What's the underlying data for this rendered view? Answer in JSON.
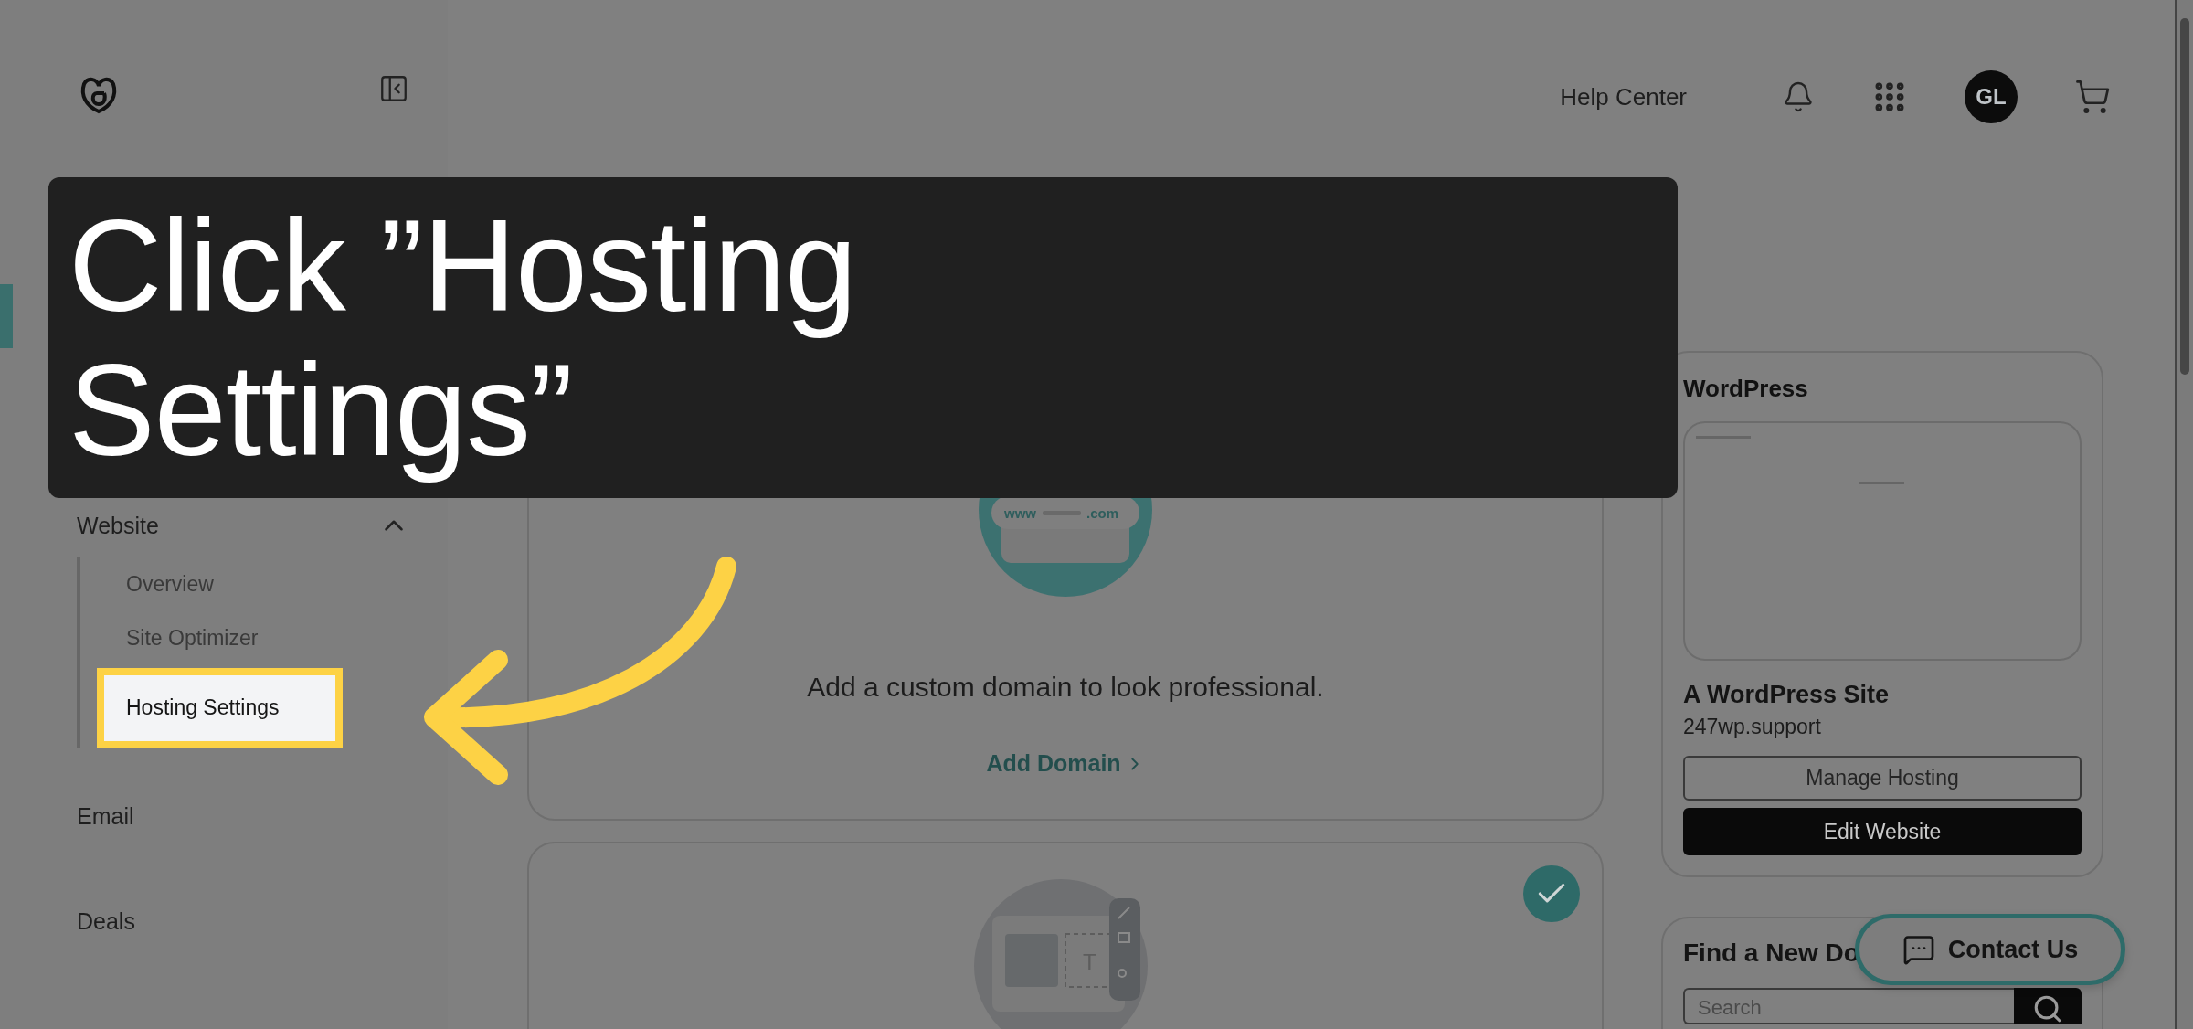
{
  "header": {
    "help_link": "Help Center",
    "avatar_initials": "GL"
  },
  "sidebar": {
    "items": [
      {
        "kind": "group",
        "label": "Website",
        "expanded": true,
        "children": [
          {
            "label": "Overview",
            "selected": false
          },
          {
            "label": "Site Optimizer",
            "selected": false
          },
          {
            "label": "Hosting Settings",
            "selected": true
          }
        ]
      },
      {
        "kind": "link",
        "label": "Email"
      },
      {
        "kind": "link",
        "label": "Deals"
      }
    ]
  },
  "callout": {
    "text": "Click ”Hosting Settings”"
  },
  "domain_card": {
    "illustration_labels": [
      "www",
      ".com"
    ],
    "message": "Add a custom domain to look professional.",
    "link": "Add Domain"
  },
  "builder_card": {
    "completed": true,
    "tool_glyph": "T"
  },
  "site_card": {
    "title": "WordPress",
    "site_name": "A WordPress Site",
    "domain": "247wp.support",
    "buttons": [
      {
        "label": "Manage Hosting",
        "kind": "outline"
      },
      {
        "label": "Edit Website",
        "kind": "solid"
      }
    ]
  },
  "domain_search": {
    "title": "Find a New Do",
    "placeholder": "Search"
  },
  "contact_button": {
    "label": "Contact Us"
  }
}
